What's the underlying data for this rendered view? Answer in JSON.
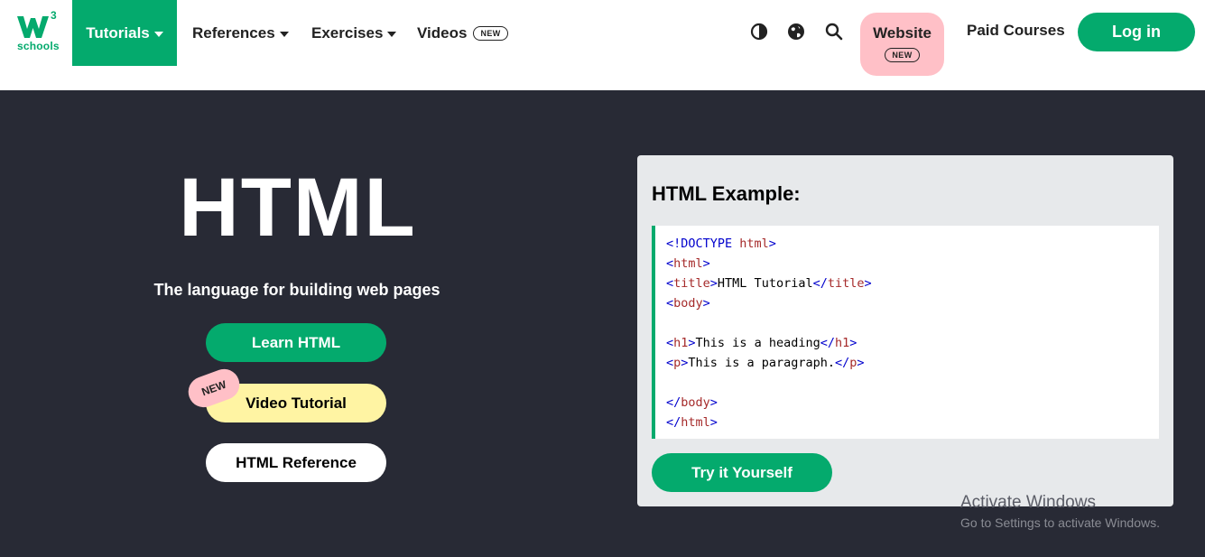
{
  "nav": {
    "logo": {
      "mark": "W",
      "superscript": "3",
      "word": "schools"
    },
    "items": [
      {
        "label": "Tutorials",
        "dropdown": true,
        "active": true
      },
      {
        "label": "References",
        "dropdown": true
      },
      {
        "label": "Exercises",
        "dropdown": true
      },
      {
        "label": "Videos",
        "badge": "NEW"
      }
    ],
    "icons": [
      "contrast-icon",
      "globe-icon",
      "search-icon"
    ],
    "website": {
      "label": "Website",
      "badge": "NEW"
    },
    "paid_courses": "Paid Courses",
    "login": "Log in"
  },
  "hero": {
    "title": "HTML",
    "subtitle": "The language for building web pages",
    "buttons": {
      "learn": "Learn HTML",
      "video": "Video Tutorial",
      "video_badge": "NEW",
      "reference": "HTML Reference"
    }
  },
  "example": {
    "title": "HTML Example:",
    "try_button": "Try it Yourself",
    "code": {
      "l1_open": "<!DOCTYPE ",
      "l1_name": "html",
      "l1_close": ">",
      "l2_open": "<",
      "l2_name": "html",
      "l2_close": ">",
      "l3_open": "<",
      "l3_name": "title",
      "l3_close": ">",
      "l3_text": "HTML Tutorial",
      "l3_open2": "</",
      "l3_name2": "title",
      "l3_close2": ">",
      "l4_open": "<",
      "l4_name": "body",
      "l4_close": ">",
      "l6_open": "<",
      "l6_name": "h1",
      "l6_close": ">",
      "l6_text": "This is a heading",
      "l6_open2": "</",
      "l6_name2": "h1",
      "l6_close2": ">",
      "l7_open": "<",
      "l7_name": "p",
      "l7_close": ">",
      "l7_text": "This is a paragraph.",
      "l7_open2": "</",
      "l7_name2": "p",
      "l7_close2": ">",
      "l9_open": "</",
      "l9_name": "body",
      "l9_close": ">",
      "l10_open": "</",
      "l10_name": "html",
      "l10_close": ">"
    }
  },
  "watermark": {
    "line1": "Activate Windows",
    "line2": "Go to Settings to activate Windows."
  },
  "colors": {
    "accent": "#04AA6D",
    "dark_bg": "#282A35",
    "pink": "#FFC0C7",
    "yellow": "#FFF4A3",
    "panel": "#E7E9EB"
  }
}
